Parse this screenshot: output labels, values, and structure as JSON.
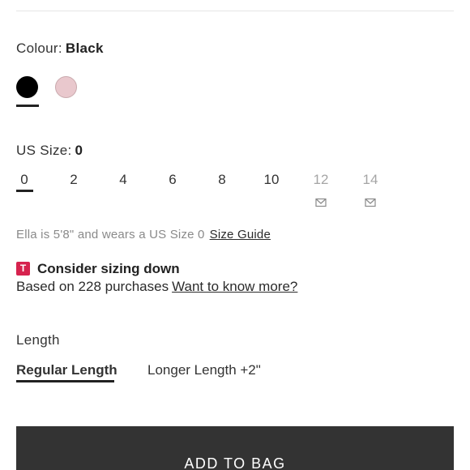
{
  "colour": {
    "label": "Colour:",
    "selected": "Black",
    "swatches": [
      {
        "name": "Black",
        "hex": "#000000"
      },
      {
        "name": "Pink",
        "hex": "#e9c8cd"
      }
    ]
  },
  "size": {
    "label": "US Size:",
    "selected": "0",
    "options": [
      {
        "value": "0",
        "available": true
      },
      {
        "value": "2",
        "available": true
      },
      {
        "value": "4",
        "available": true
      },
      {
        "value": "6",
        "available": true
      },
      {
        "value": "8",
        "available": true
      },
      {
        "value": "10",
        "available": true
      },
      {
        "value": "12",
        "available": false,
        "icon": "mail-icon"
      },
      {
        "value": "14",
        "available": false,
        "icon": "mail-icon"
      }
    ]
  },
  "model_note": {
    "text": "Ella is 5'8\" and wears a US Size 0",
    "link": "Size Guide"
  },
  "sizing_advice": {
    "badge": "T",
    "title": "Consider sizing down",
    "subtitle": "Based on 228 purchases",
    "link": "Want to know more?"
  },
  "length": {
    "label": "Length",
    "options": [
      "Regular Length",
      "Longer Length +2\""
    ],
    "selected": "Regular Length"
  },
  "cta": {
    "label": "ADD TO BAG"
  }
}
